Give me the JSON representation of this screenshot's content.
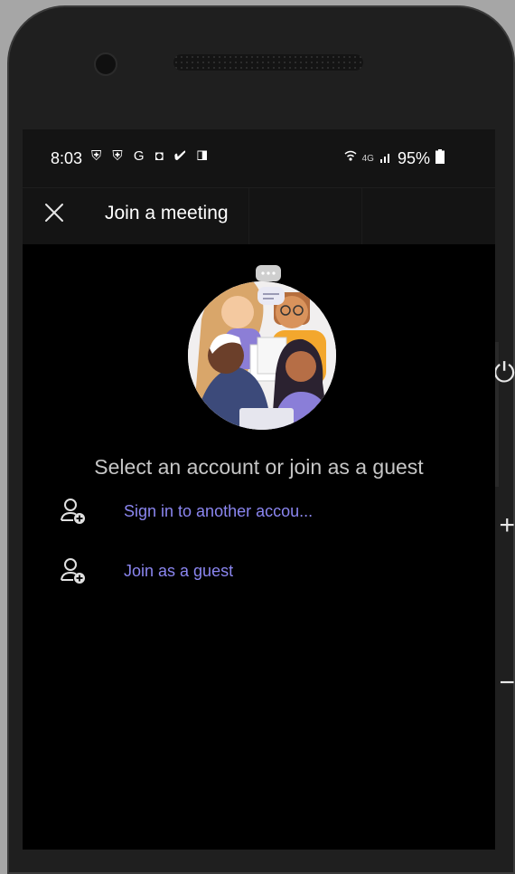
{
  "status_bar": {
    "time": "8:03",
    "left_icons": "⛨ ⛨ G ◘ ✔ ◨",
    "network": "4G",
    "battery": "95%"
  },
  "header": {
    "close_icon": "close-icon",
    "title": "Join a meeting"
  },
  "main": {
    "prompt": "Select an account or join as a guest",
    "options": [
      {
        "label": "Sign in to another accou...",
        "icon": "add-person-icon"
      },
      {
        "label": "Join as a guest",
        "icon": "add-person-icon"
      }
    ]
  },
  "device": {
    "side_icons": [
      "⏻",
      "+",
      "−"
    ]
  },
  "colors": {
    "accent": "#8b86f0",
    "background": "#000000",
    "bar": "#141414"
  }
}
